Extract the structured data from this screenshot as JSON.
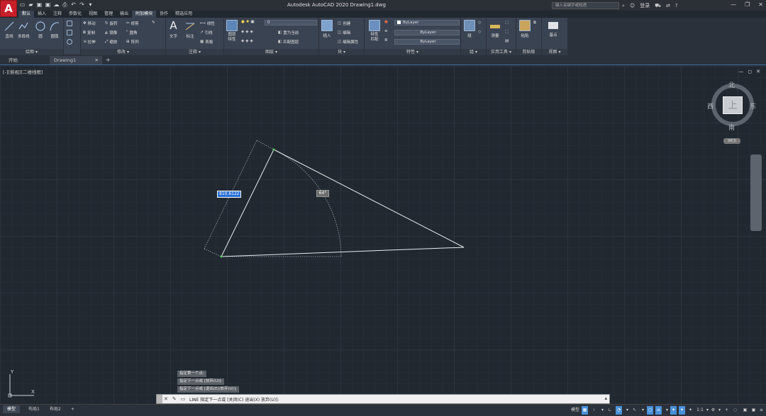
{
  "app": {
    "logo": "A",
    "title": "Autodesk AutoCAD 2020    Drawing1.dwg",
    "search_placeholder": "键入关键字或短语",
    "login": "登录",
    "window_controls": [
      "—",
      "❐",
      "✕"
    ]
  },
  "ribbon_tabs": [
    "默认",
    "插入",
    "注释",
    "参数化",
    "视图",
    "管理",
    "输出",
    "附加模块",
    "协作",
    "精选应用"
  ],
  "ribbon": {
    "draw": {
      "title": "绘图 ▾",
      "line": "直线",
      "polyline": "多段线",
      "circle": "圆",
      "arc": "圆弧"
    },
    "modify": {
      "title": "修改 ▾",
      "move": "移动",
      "rotate": "旋转",
      "trim": "修剪",
      "copy": "复制",
      "mirror": "镜像",
      "fillet": "圆角",
      "stretch": "拉伸",
      "scale": "缩放",
      "array": "阵列"
    },
    "annotation": {
      "title": "注释 ▾",
      "text": "文字",
      "dimension": "标注",
      "linear": "线性",
      "leader": "引线",
      "table": "表格"
    },
    "layers": {
      "title": "图层 ▾",
      "layer_properties": "图层\n特性",
      "layer_value": "0",
      "make_current": "置为当前",
      "match_layer": "匹配图层"
    },
    "block": {
      "title": "块 ▾",
      "insert": "插入",
      "create": "创建",
      "edit": "编辑",
      "edit_attr": "编辑属性"
    },
    "properties": {
      "title": "特性 ▾",
      "match": "特性\n匹配",
      "color": "ByLayer",
      "linetype": "ByLayer",
      "lineweight": "ByLayer"
    },
    "groups": {
      "title": "组 ▾",
      "group": "组"
    },
    "utilities": {
      "title": "实用工具 ▾",
      "measure": "测量"
    },
    "clipboard": {
      "title": "剪贴板",
      "paste": "粘贴"
    },
    "view": {
      "title": "视图 ▾",
      "base": "基点"
    }
  },
  "file_tabs": {
    "start": "开始",
    "drawing": "Drawing1",
    "close": "✕",
    "add": "+"
  },
  "viewport": {
    "label": "[-][俯视][二维线框]",
    "controls": [
      "—",
      "◻",
      "✕"
    ]
  },
  "viewcube": {
    "top": "上",
    "north": "北",
    "south": "南",
    "east": "东",
    "west": "西",
    "wcs": "WCS"
  },
  "dynamic_input": {
    "length": "810.6122",
    "angle": "64°"
  },
  "command_history": [
    "指定第一个点:",
    "指定下一点或 [放弃(U)]:",
    "指定下一点或 [退出(E)/放弃(U)]:"
  ],
  "command_line": {
    "prompt": "LINE 指定下一点或 [关闭(C) 退出(X) 放弃(U)]:"
  },
  "ucs": {
    "x": "X",
    "y": "Y"
  },
  "layout_tabs": [
    "模型",
    "布局1",
    "布局2"
  ],
  "status": {
    "model": "模型",
    "scale": "1:1"
  }
}
